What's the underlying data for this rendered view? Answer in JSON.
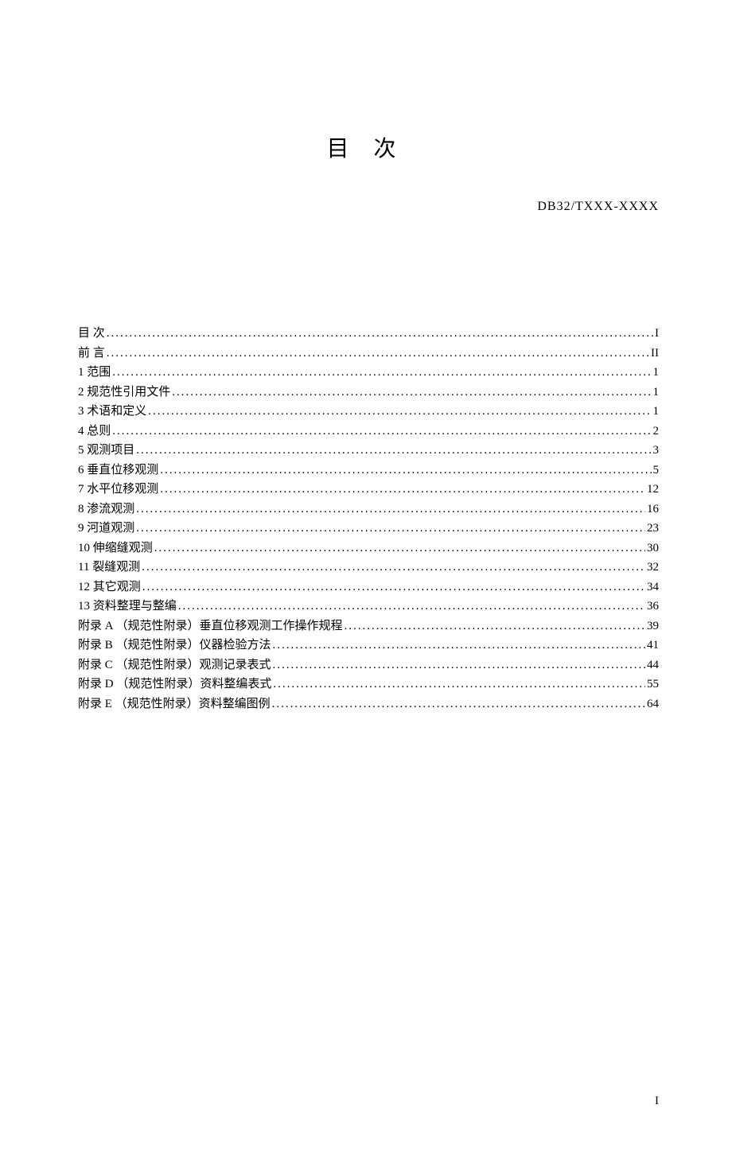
{
  "header": {
    "doc_code": "DB32/TXXX-XXXX"
  },
  "title": "目 次",
  "toc": [
    {
      "label": "目   次",
      "page": "I",
      "spaced": false
    },
    {
      "label": "前   言",
      "page": "II",
      "spaced": false
    },
    {
      "label": "1  范围",
      "page": "1",
      "spaced": false
    },
    {
      "label": "2  规范性引用文件",
      "page": "1",
      "spaced": false
    },
    {
      "label": "3  术语和定义",
      "page": "1",
      "spaced": false
    },
    {
      "label": "4  总则",
      "page": "2",
      "spaced": false
    },
    {
      "label": "5  观测项目",
      "page": "3",
      "spaced": false
    },
    {
      "label": "6  垂直位移观测",
      "page": "5",
      "spaced": false
    },
    {
      "label": "7  水平位移观测",
      "page": "12",
      "spaced": false
    },
    {
      "label": "8  渗流观测",
      "page": "16",
      "spaced": false
    },
    {
      "label": "9  河道观测",
      "page": "23",
      "spaced": false
    },
    {
      "label": "10  伸缩缝观测",
      "page": "30",
      "spaced": false
    },
    {
      "label": "11  裂缝观测",
      "page": "32",
      "spaced": false
    },
    {
      "label": "12  其它观测",
      "page": "34",
      "spaced": false
    },
    {
      "label": "13  资料整理与整编",
      "page": "36",
      "spaced": false
    },
    {
      "label": "附录 A （规范性附录）垂直位移观测工作操作规程",
      "page": "39",
      "spaced": false
    },
    {
      "label": "附录 B （规范性附录）仪器检验方法",
      "page": "41",
      "spaced": false
    },
    {
      "label": "附录 C （规范性附录）观测记录表式",
      "page": "44",
      "spaced": false
    },
    {
      "label": "附录 D （规范性附录）资料整编表式",
      "page": "55",
      "spaced": false
    },
    {
      "label": "附录 E （规范性附录）资料整编图例",
      "page": "64",
      "spaced": false
    }
  ],
  "footer": {
    "page_number": "I"
  }
}
